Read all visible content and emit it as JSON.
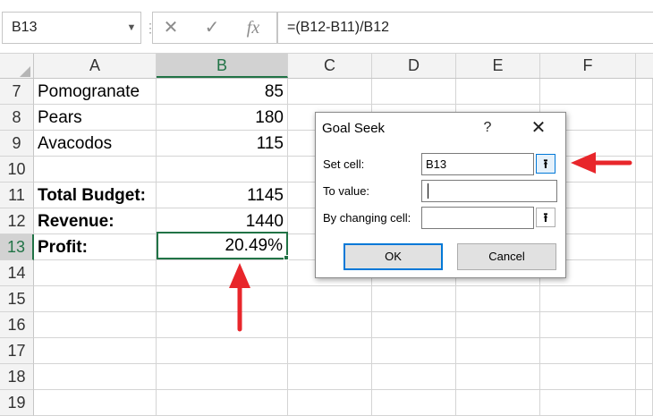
{
  "formula_bar": {
    "name_box": "B13",
    "cancel_glyph": "✕",
    "enter_glyph": "✓",
    "fx_glyph": "fx",
    "formula": "=(B12-B11)/B12"
  },
  "columns": [
    "A",
    "B",
    "C",
    "D",
    "E",
    "F"
  ],
  "rows": [
    {
      "num": "7",
      "a": "Pomogranate",
      "b": "85",
      "bold": false
    },
    {
      "num": "8",
      "a": "Pears",
      "b": "180",
      "bold": false
    },
    {
      "num": "9",
      "a": "Avacodos",
      "b": "115",
      "bold": false
    },
    {
      "num": "10",
      "a": "",
      "b": "",
      "bold": false
    },
    {
      "num": "11",
      "a": "Total Budget:",
      "b": "1145",
      "bold": true
    },
    {
      "num": "12",
      "a": "Revenue:",
      "b": "1440",
      "bold": true
    },
    {
      "num": "13",
      "a": "Profit:",
      "b": "20.49%",
      "bold": true
    },
    {
      "num": "14",
      "a": "",
      "b": "",
      "bold": false
    },
    {
      "num": "15",
      "a": "",
      "b": "",
      "bold": false
    },
    {
      "num": "16",
      "a": "",
      "b": "",
      "bold": false
    },
    {
      "num": "17",
      "a": "",
      "b": "",
      "bold": false
    },
    {
      "num": "18",
      "a": "",
      "b": "",
      "bold": false
    },
    {
      "num": "19",
      "a": "",
      "b": "",
      "bold": false
    }
  ],
  "dialog": {
    "title": "Goal Seek",
    "help": "?",
    "close": "✕",
    "set_cell_label": "Set cell:",
    "set_cell_value": "B13",
    "to_value_label": "To value:",
    "to_value_value": "",
    "by_changing_label": "By changing cell:",
    "by_changing_value": "",
    "ref_glyph": "⭱",
    "ok_label": "OK",
    "cancel_label": "Cancel"
  },
  "annotations": {
    "arrow_color": "#e8262b"
  }
}
